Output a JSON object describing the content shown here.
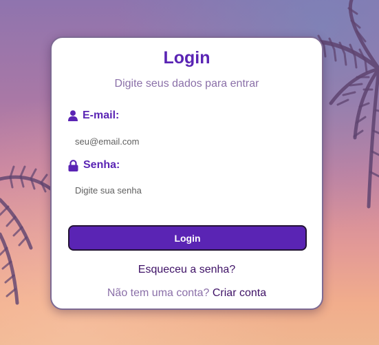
{
  "login": {
    "title": "Login",
    "subtitle": "Digite seus dados para entrar",
    "email": {
      "label": "E-mail:",
      "icon": "user-icon",
      "value": "",
      "placeholder": "seu@email.com"
    },
    "password": {
      "label": "Senha:",
      "icon": "lock-icon",
      "value": "",
      "placeholder": "Digite sua senha"
    },
    "submit_label": "Login",
    "forgot_label": "Esqueceu a senha?",
    "signup_prompt": "Não tem uma conta?",
    "signup_link": "Criar conta"
  },
  "colors": {
    "accent": "#5a24b4",
    "link": "#3e1166",
    "muted": "#8a6fa8"
  }
}
